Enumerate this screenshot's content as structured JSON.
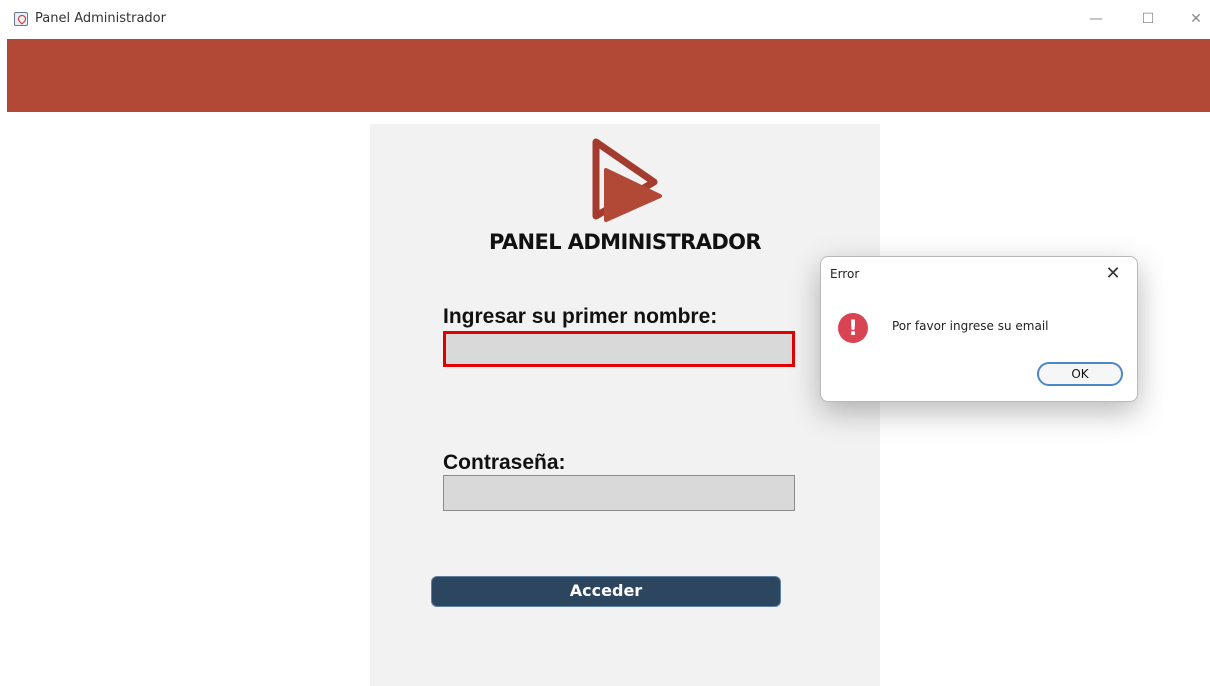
{
  "window": {
    "title": "Panel Administrador",
    "minimize_glyph": "—",
    "maximize_glyph": "☐",
    "close_glyph": "✕",
    "header_color": "#b24836"
  },
  "login": {
    "title": "PANEL ADMINISTRADOR",
    "name_label": "Ingresar su primer nombre:",
    "name_value": "",
    "password_label": "Contraseña:",
    "password_value": "",
    "submit_label": "Acceder",
    "logo_icon": "play-logo-icon"
  },
  "dialog": {
    "title": "Error",
    "close_glyph": "✕",
    "icon": "error-icon",
    "icon_glyph": "!",
    "message": "Por favor ingrese su email",
    "ok_label": "OK",
    "icon_color": "#d84451"
  }
}
